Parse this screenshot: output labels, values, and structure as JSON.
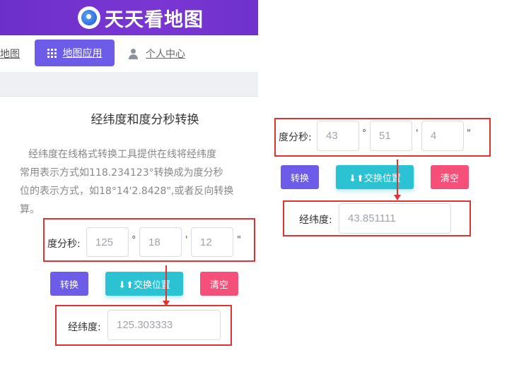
{
  "app": {
    "logo_text": "天天看地图"
  },
  "nav": {
    "map": "地图",
    "apps": "地图应用",
    "user": "个人中心"
  },
  "page": {
    "title": "经纬度和度分秒转换",
    "description_lines": [
      "经纬度在线格式转换工具提供在线将经纬度",
      "常用表示方式如118.234123°转换成为度分秒",
      "位的表示方式，如18°14'2.8428\",或者反向转换",
      "算。"
    ]
  },
  "converter_left": {
    "dms_label": "度分秒:",
    "degree": "125",
    "minute": "18",
    "second": "12",
    "unit_degree": "°",
    "unit_minute": "'",
    "unit_second": "\"",
    "buttons": {
      "convert": "转换",
      "swap": "⬇⬆交换位置",
      "clear": "清空"
    },
    "decimal_label": "经纬度:",
    "decimal_value": "125.303333"
  },
  "converter_right": {
    "dms_label": "度分秒:",
    "degree": "43",
    "minute": "51",
    "second": "4",
    "unit_degree": "°",
    "unit_minute": "'",
    "unit_second": "\"",
    "buttons": {
      "convert": "转换",
      "swap": "⬇⬆交换位置",
      "clear": "清空"
    },
    "decimal_label": "经纬度:",
    "decimal_value": "43.851111"
  },
  "colors": {
    "header": "#7033cc",
    "primary": "#6c5ce7",
    "swap": "#2bc3d3",
    "clear": "#f5507a",
    "annotation": "#dd3333"
  }
}
